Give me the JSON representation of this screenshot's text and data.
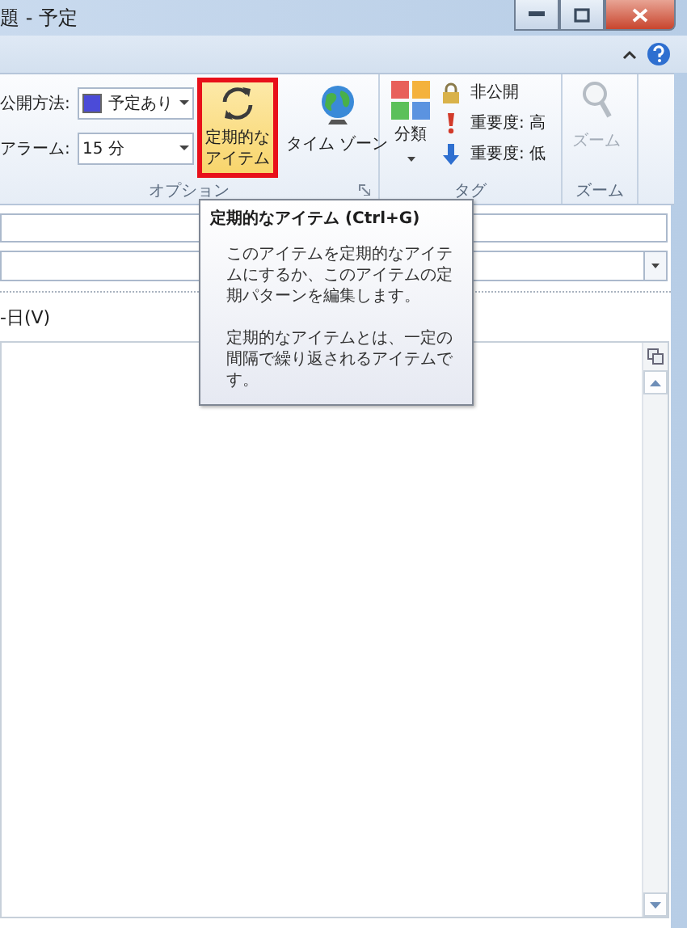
{
  "window": {
    "title": "題 - 予定"
  },
  "ribbon": {
    "options": {
      "fields": [
        {
          "label": "公開方法:",
          "value": "予定あり",
          "color": "#4b4bd8"
        },
        {
          "label": "アラーム:",
          "value": "15 分"
        }
      ],
      "buttons": [
        {
          "kind": "recurrence",
          "label": "定期的なアイテム",
          "highlighted": true
        },
        {
          "kind": "timezone",
          "label": "タイム ゾーン",
          "highlighted": false
        }
      ],
      "group_label": "オプション"
    },
    "tags": {
      "category": "分類",
      "items": [
        {
          "kind": "lock",
          "label": "非公開"
        },
        {
          "kind": "high",
          "label": "重要度: 高"
        },
        {
          "kind": "low",
          "label": "重要度: 低"
        }
      ],
      "group_label": "タグ"
    },
    "zoom": {
      "button": "ズーム",
      "disabled": true,
      "group_label": "ズーム"
    }
  },
  "tooltip": {
    "title": "定期的なアイテム (Ctrl+G)",
    "paragraphs": [
      "このアイテムを定期的なアイテムにするか、このアイテムの定期パターンを編集します。",
      "定期的なアイテムとは、一定の間隔で繰り返されるアイテムです。"
    ]
  },
  "form": {
    "option_label": "-日(V)"
  }
}
